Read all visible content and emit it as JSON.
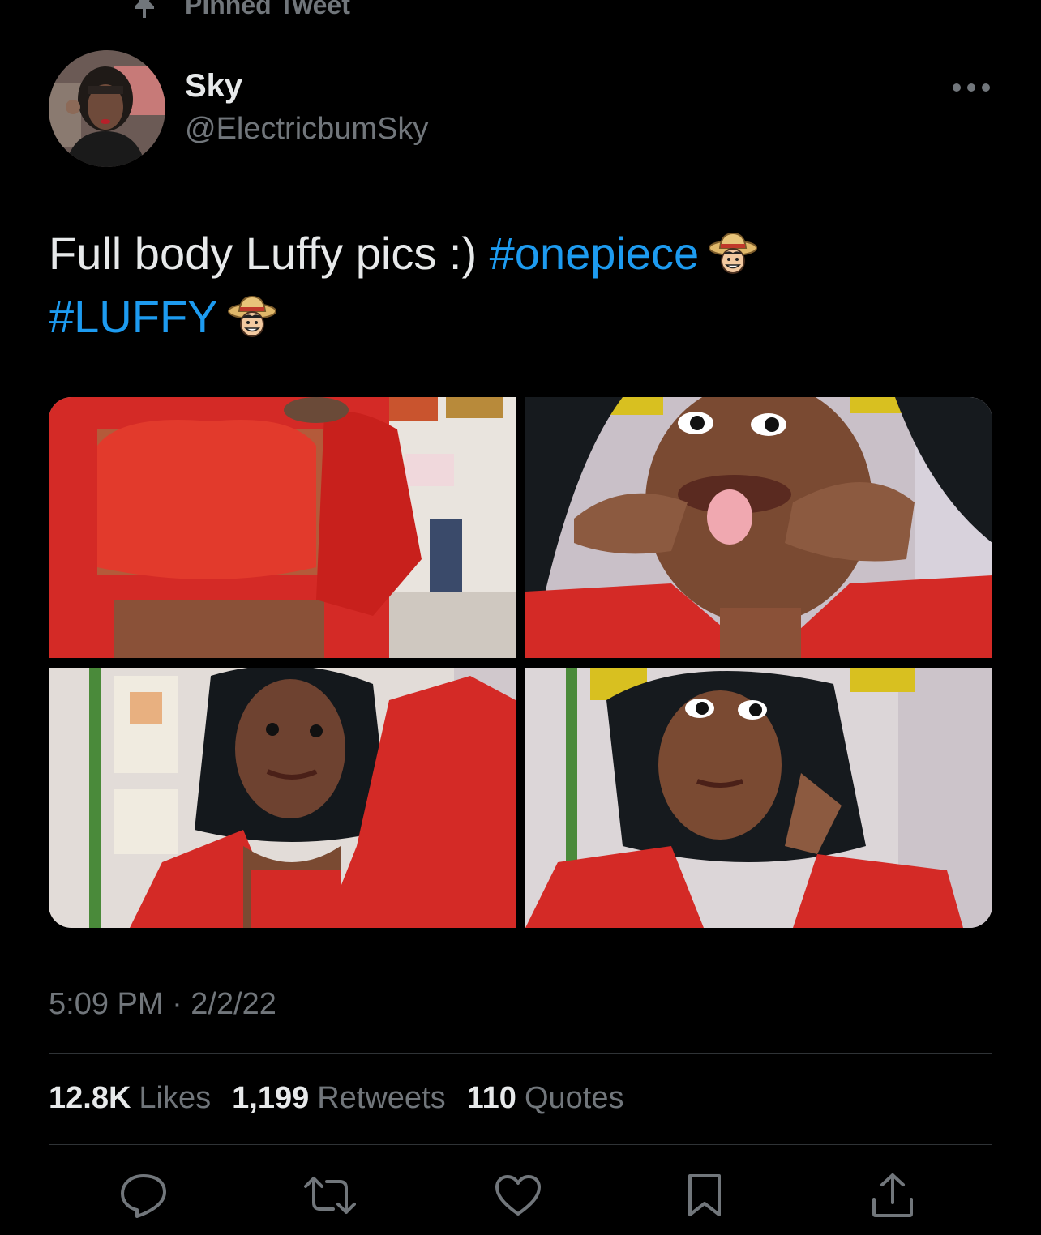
{
  "pinned": {
    "label": "Pinned Tweet",
    "icon": "pin-icon"
  },
  "author": {
    "name": "Sky",
    "handle": "@ElectricbumSky",
    "avatar_icon": "avatar"
  },
  "tweet": {
    "text_plain": "Full body Luffy pics :) ",
    "hashtag1": "#onepiece",
    "hashtag2": "#LUFFY",
    "emoji": "straw-hat-luffy-emoji"
  },
  "media": {
    "count": 4
  },
  "timestamp": "5:09 PM · 2/2/22",
  "stats": {
    "likes_count": "12.8K",
    "likes_label": "Likes",
    "retweets_count": "1,199",
    "retweets_label": "Retweets",
    "quotes_count": "110",
    "quotes_label": "Quotes"
  },
  "actions": [
    "reply-icon",
    "retweet-icon",
    "like-icon",
    "bookmark-icon",
    "share-icon"
  ],
  "colors": {
    "background": "#000000",
    "text": "#e7e9ea",
    "secondary": "#71767b",
    "accent": "#1d9bf0",
    "divider": "#2f3336"
  }
}
